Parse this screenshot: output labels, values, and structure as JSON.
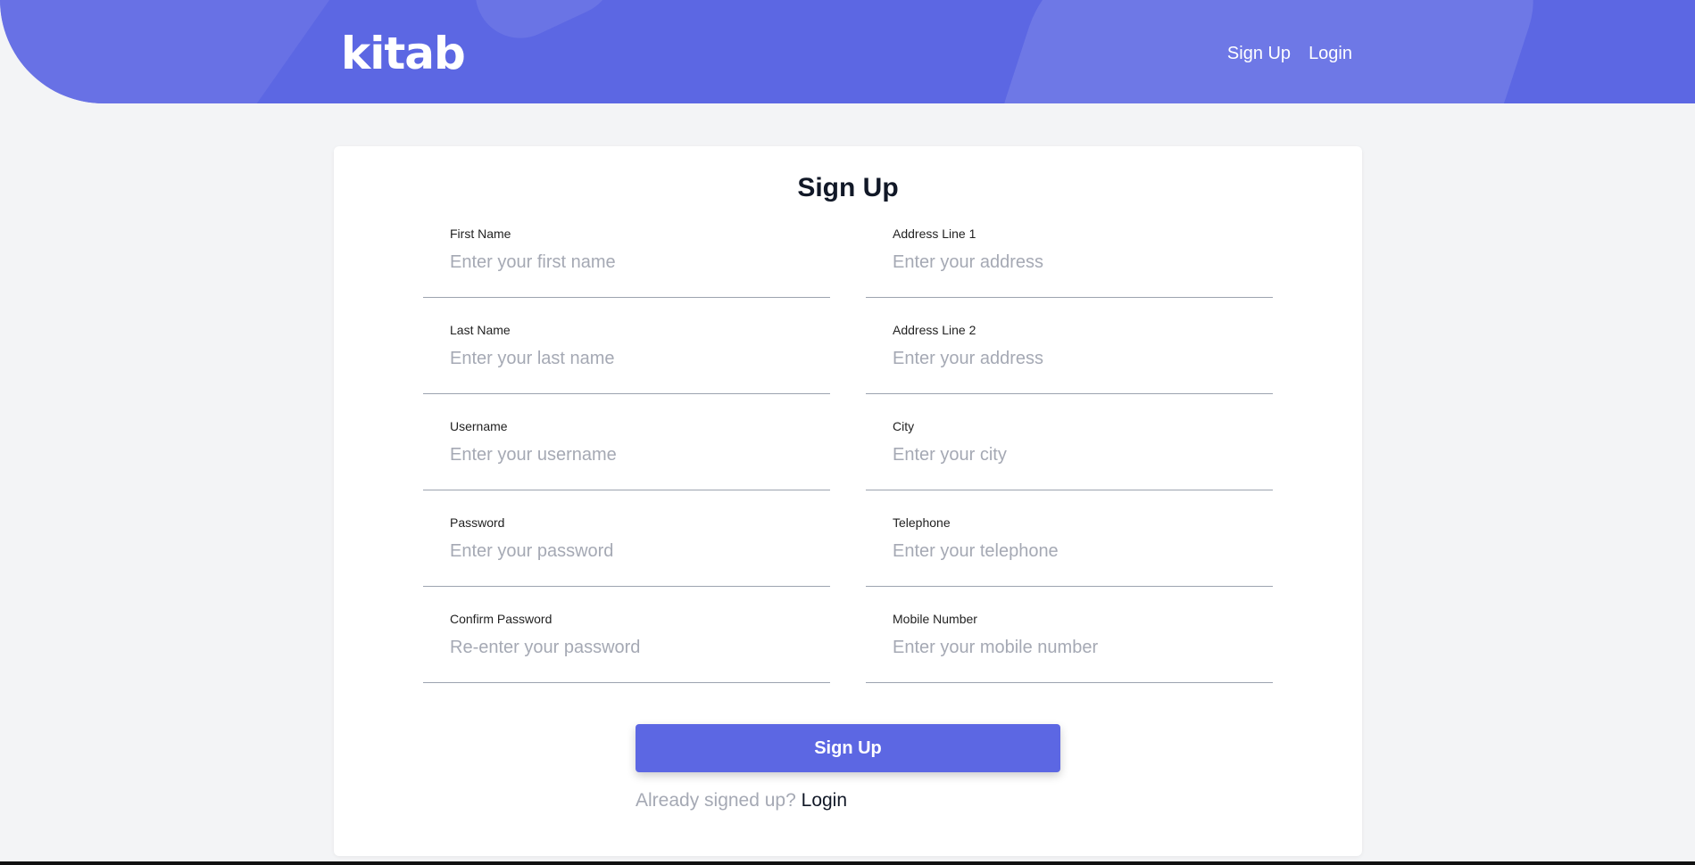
{
  "header": {
    "logo": "kitab",
    "nav": {
      "signup": "Sign Up",
      "login": "Login"
    }
  },
  "form": {
    "title": "Sign Up",
    "left_fields": [
      {
        "label": "First Name",
        "placeholder": "Enter your first name",
        "value": ""
      },
      {
        "label": "Last Name",
        "placeholder": "Enter your last name",
        "value": ""
      },
      {
        "label": "Username",
        "placeholder": "Enter your username",
        "value": ""
      },
      {
        "label": "Password",
        "placeholder": "Enter your password",
        "value": ""
      },
      {
        "label": "Confirm Password",
        "placeholder": "Re-enter your password",
        "value": ""
      }
    ],
    "right_fields": [
      {
        "label": "Address Line 1",
        "placeholder": "Enter your address",
        "value": ""
      },
      {
        "label": "Address Line 2",
        "placeholder": "Enter your address",
        "value": ""
      },
      {
        "label": "City",
        "placeholder": "Enter your city",
        "value": ""
      },
      {
        "label": "Telephone",
        "placeholder": "Enter your telephone",
        "value": ""
      },
      {
        "label": "Mobile Number",
        "placeholder": "Enter your mobile number",
        "value": ""
      }
    ],
    "submit_label": "Sign Up",
    "already_text": "Already signed up?",
    "login_link": "Login"
  },
  "colors": {
    "accent": "#5c67e3",
    "background": "#f3f4f6",
    "placeholder": "#a5a9b4"
  }
}
